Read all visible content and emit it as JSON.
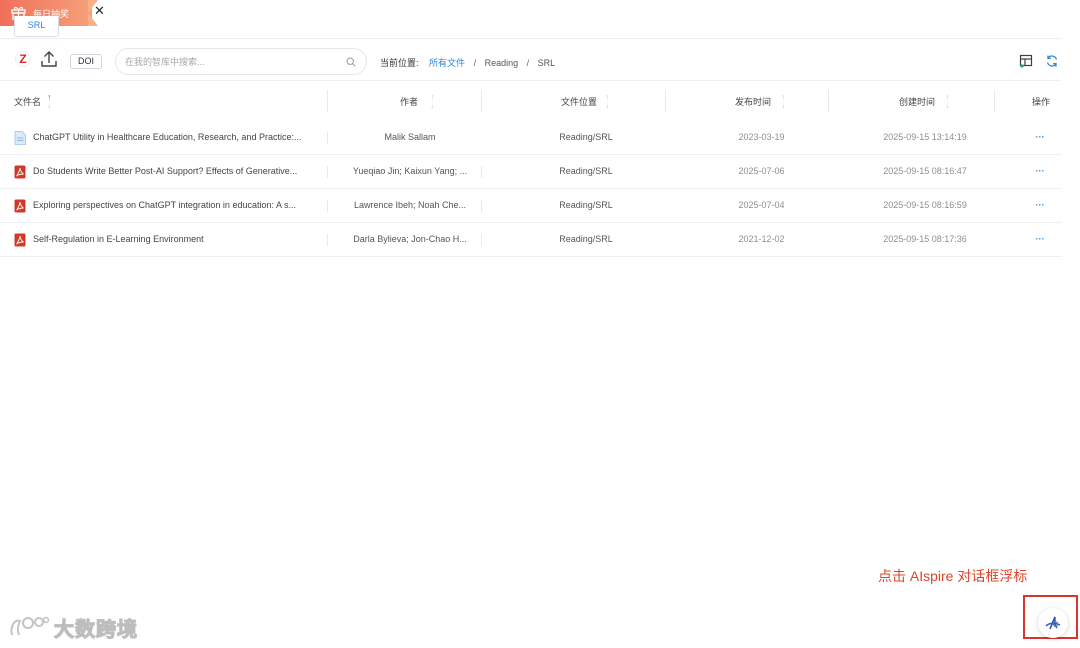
{
  "gift_banner": {
    "text": "每日抽奖",
    "close": "✕"
  },
  "folder_tab": {
    "label": "SRL"
  },
  "toolbar": {
    "z_label": "Z",
    "doi_label": "DOI",
    "search_placeholder": "在我的智库中搜索...",
    "breadcrumb": {
      "prefix": "当前位置:",
      "root": "所有文件",
      "items": [
        "Reading",
        "SRL"
      ],
      "separator": "/"
    }
  },
  "table": {
    "headers": {
      "name": "文件名",
      "author": "作者",
      "location": "文件位置",
      "published": "发布时间",
      "created": "创建时间",
      "ops": "操作"
    },
    "sort_up": "↑",
    "sort_down": "↓",
    "rows": [
      {
        "icon": "doc-icon",
        "name": "ChatGPT Utility in Healthcare Education, Research, and Practice:...",
        "author": "Malik Sallam",
        "location": "Reading/SRL",
        "published": "2023-03-19",
        "created": "2025-09-15 13:14:19",
        "ops": "···"
      },
      {
        "icon": "pdf-icon",
        "name": "Do Students Write Better Post-AI Support? Effects of Generative...",
        "author": "Yueqiao Jin; Kaixun Yang; ...",
        "location": "Reading/SRL",
        "published": "2025-07-06",
        "created": "2025-09-15 08:16:47",
        "ops": "···"
      },
      {
        "icon": "pdf-icon",
        "name": "Exploring perspectives on ChatGPT integration in education: A s...",
        "author": "Lawrence Ibeh; Noah Che...",
        "location": "Reading/SRL",
        "published": "2025-07-04",
        "created": "2025-09-15 08:16:59",
        "ops": "···"
      },
      {
        "icon": "pdf-icon",
        "name": "Self-Regulation in E-Learning Environment",
        "author": "Darla Bylieva; Jon-Chao H...",
        "location": "Reading/SRL",
        "published": "2021-12-02",
        "created": "2025-09-15 08:17:36",
        "ops": "···"
      }
    ]
  },
  "annotation": {
    "text": "点击 AIspire 对话框浮标"
  },
  "watermark": {
    "text": "大数跨境"
  },
  "colors": {
    "accent": "#2f86d6",
    "annotation": "#e0442a",
    "pdf": "#d0392b",
    "banner": "#f0705a"
  }
}
